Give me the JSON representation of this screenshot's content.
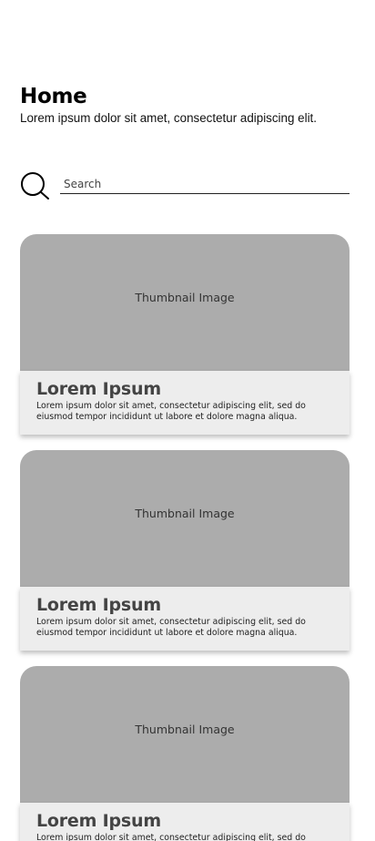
{
  "header": {
    "title": "Home",
    "subtitle": "Lorem ipsum dolor sit amet, consectetur adipiscing elit."
  },
  "search": {
    "icon": "search-icon",
    "placeholder": "Search"
  },
  "cards": [
    {
      "thumbnail_label": "Thumbnail Image",
      "title": "Lorem Ipsum",
      "description": "Lorem ipsum dolor sit amet, consectetur adipiscing elit, sed do eiusmod tempor incididunt ut labore et dolore magna aliqua."
    },
    {
      "thumbnail_label": "Thumbnail Image",
      "title": "Lorem Ipsum",
      "description": "Lorem ipsum dolor sit amet, consectetur adipiscing elit, sed do eiusmod tempor incididunt ut labore et dolore magna aliqua."
    },
    {
      "thumbnail_label": "Thumbnail Image",
      "title": "Lorem Ipsum",
      "description": "Lorem ipsum dolor sit amet, consectetur adipiscing elit, sed do eiusmod tempor incididunt ut labore et dolore magna aliqua."
    }
  ],
  "colors": {
    "thumbnail_bg": "#acacac",
    "caption_bg": "#ededed",
    "card_title": "#444444"
  }
}
